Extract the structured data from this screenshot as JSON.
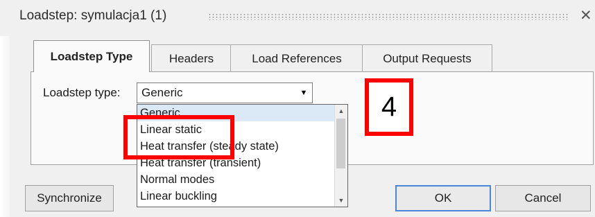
{
  "window": {
    "title": "Loadstep: symulacja1 (1)",
    "close_icon": "close-icon"
  },
  "tabs": [
    {
      "label": "Loadstep Type",
      "active": true
    },
    {
      "label": "Headers",
      "active": false
    },
    {
      "label": "Load References",
      "active": false
    },
    {
      "label": "Output Requests",
      "active": false
    }
  ],
  "form": {
    "loadstep_type_label": "Loadstep type:",
    "loadstep_type_value": "Generic",
    "combo_arrow_icon": "chevron-down-icon"
  },
  "dropdown": {
    "options": [
      {
        "label": "Generic",
        "selected": true
      },
      {
        "label": "Linear static",
        "selected": false
      },
      {
        "label": "Heat transfer (steady state)",
        "selected": false
      },
      {
        "label": "Heat transfer (transient)",
        "selected": false
      },
      {
        "label": "Normal modes",
        "selected": false
      },
      {
        "label": "Linear buckling",
        "selected": false
      }
    ]
  },
  "buttons": {
    "synchronize": "Synchronize",
    "ok": "OK",
    "cancel": "Cancel"
  },
  "annotation": {
    "step_number": "4",
    "highlight_color": "#ff0000"
  }
}
